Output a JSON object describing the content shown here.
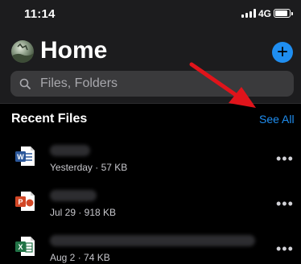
{
  "status_bar": {
    "time": "11:14",
    "network": "4G"
  },
  "header": {
    "title": "Home"
  },
  "search": {
    "placeholder": "Files, Folders"
  },
  "recent": {
    "title": "Recent Files",
    "see_all": "See All",
    "files": [
      {
        "type": "word",
        "meta": "Yesterday · 57 KB"
      },
      {
        "type": "powerpoint",
        "meta": "Jul 29 · 918 KB"
      },
      {
        "type": "excel",
        "meta": "Aug 2 · 74 KB"
      }
    ]
  },
  "more_label": "•••",
  "colors": {
    "accent": "#1f8ef1",
    "annotation_arrow": "#e0141b",
    "word": "#2b579a",
    "powerpoint": "#d24726",
    "excel": "#217346"
  },
  "icons": [
    "signal-icon",
    "battery-icon",
    "avatar",
    "plus-icon",
    "search-icon",
    "word-file-icon",
    "powerpoint-file-icon",
    "excel-file-icon",
    "more-icon",
    "annotation-arrow"
  ]
}
